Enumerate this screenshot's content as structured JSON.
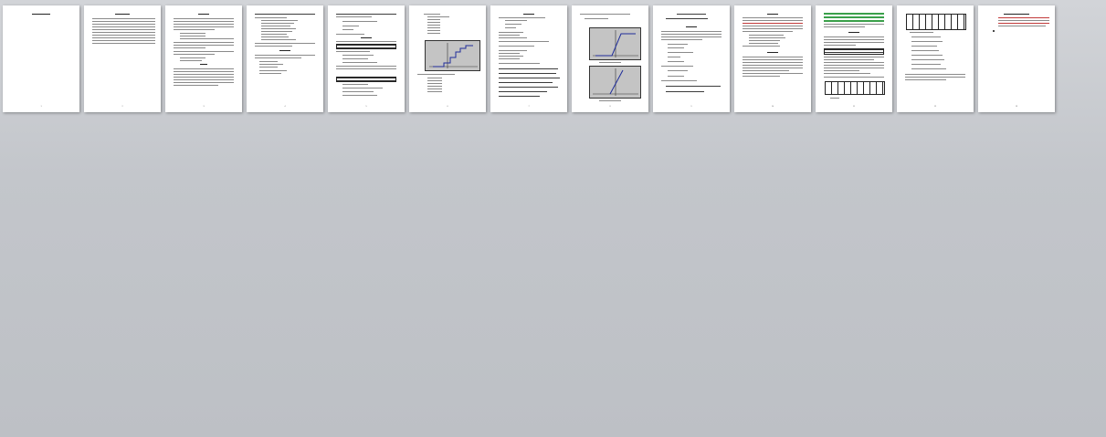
{
  "viewer": {
    "mode": "multi-page-overview",
    "background_color": "#c6c9ce"
  },
  "pages": [
    {
      "number": "1"
    },
    {
      "number": "2"
    },
    {
      "number": "3"
    },
    {
      "number": "4"
    },
    {
      "number": "5"
    },
    {
      "number": "6"
    },
    {
      "number": "7"
    },
    {
      "number": "8"
    },
    {
      "number": "9"
    },
    {
      "number": "10"
    },
    {
      "number": "11"
    },
    {
      "number": "12"
    },
    {
      "number": "13"
    }
  ],
  "accent_colors": {
    "plot_line": "#1f2d9a",
    "plot_area": "#c4c4c4",
    "highlight_green": "#3aa04a",
    "highlight_red": "#c23a3a"
  }
}
